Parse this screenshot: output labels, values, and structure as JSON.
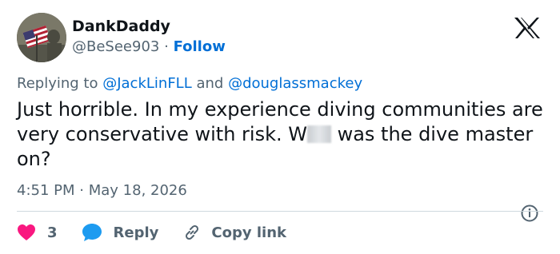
{
  "author": {
    "display_name": "DankDaddy",
    "handle": "@BeSee903",
    "separator": "·",
    "follow_label": "Follow"
  },
  "platform": {
    "logo_icon": "x-logo-icon"
  },
  "reply_context": {
    "prefix": "Replying to",
    "mention_1": "@JackLinFLL",
    "conjunction": "and",
    "mention_2": "@douglassmackey"
  },
  "tweet": {
    "text_before_redaction": "Just horrible. In my experience diving communities are very conservative with risk. W",
    "text_after_redaction": " was the dive master on?",
    "time": "4:51 PM",
    "date_separator": "·",
    "date": "May 18, 2026"
  },
  "actions": {
    "like_count": "3",
    "reply_label": "Reply",
    "copy_link_label": "Copy link"
  },
  "colors": {
    "accent_blue": "#006fd6",
    "like_red": "#f91880",
    "reply_blue": "#1d9bf0",
    "secondary_text": "#536471",
    "primary_text": "#0f1419",
    "divider": "#cfd9de"
  }
}
